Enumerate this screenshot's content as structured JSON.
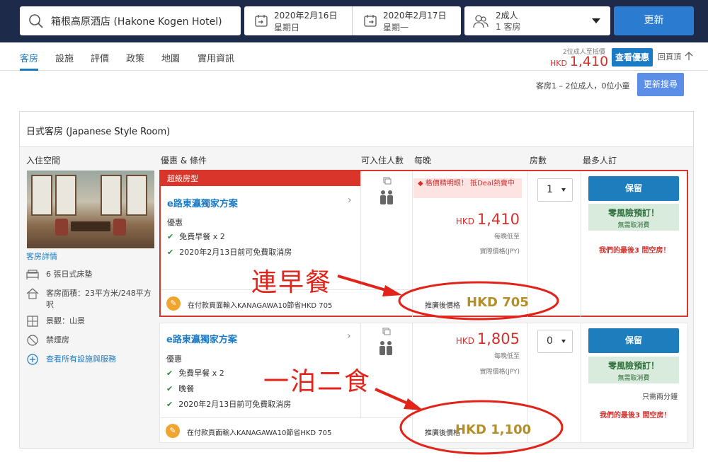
{
  "header": {
    "search_value": "箱根高原酒店 (Hakone Kogen Hotel)",
    "checkin_date": "2020年2月16日",
    "checkin_day": "星期日",
    "checkout_date": "2020年2月17日",
    "checkout_day": "星期一",
    "guests": "2成人",
    "rooms": "1 客房",
    "update_label": "更新"
  },
  "nav": {
    "tabs": [
      "客房",
      "設施",
      "評價",
      "政策",
      "地圖",
      "實用資訊"
    ],
    "price_caption": "2位成人至抵價",
    "price_currency": "HKD",
    "price_amount": "1,410",
    "view_deal_label": "查看優惠",
    "back_top_label": "回頁頂"
  },
  "occupancy": {
    "text": "客房1 – 2位成人，0位小童",
    "update_search_label": "更新搜尋"
  },
  "room": {
    "title": "日式客房 (Japanese Style Room)",
    "columns": [
      "入住空間",
      "優惠 & 條件",
      "可入住人數",
      "每晚",
      "房數",
      "最多人訂"
    ],
    "details_link": "客房詳情",
    "features": [
      {
        "icon": "bed-icon",
        "label": "6 張日式床墊"
      },
      {
        "icon": "house-icon",
        "label": "客房面積：23平方米/248平方呎"
      },
      {
        "icon": "window-icon",
        "label": "景觀：山景"
      },
      {
        "icon": "no-smoking-icon",
        "label": "禁煙房"
      }
    ],
    "all_facilities_link": "查看所有設施與服務"
  },
  "offers": [
    {
      "badge": "超級房型",
      "plan_name": "e路東瀛獨家方案",
      "perks_heading": "優惠",
      "perks": [
        "免費早餐 x 2",
        "2020年2月13日前可免費取消房"
      ],
      "promo_text": "在付款頁面輸入KANAGAWA10節省HKD 705",
      "deal_tag": "格價精明眼！ 抵Deal熱賣中",
      "currency": "HKD",
      "price": "1,410",
      "per_night": "每晚低至",
      "actual_price": "實際價格(JPY)",
      "after_discount_label": "推廣後價格",
      "after_discount_price": "HKD 705",
      "qty": "1",
      "reserve_label": "保留",
      "norisk_title": "零風險預訂！",
      "norisk_sub": "無需取消費",
      "availability": "我們的最後3 間空房！"
    },
    {
      "plan_name": "e路東瀛獨家方案",
      "perks_heading": "優惠",
      "perks": [
        "免費早餐 x 2",
        "晚餐",
        "2020年2月13日前可免費取消房"
      ],
      "promo_text": "在付款頁面輸入KANAGAWA10節省HKD 705",
      "currency": "HKD",
      "price": "1,805",
      "per_night": "每晚低至",
      "actual_price": "實際價格(JPY)",
      "after_discount_label": "推廣後價格",
      "after_discount_price": "HKD 1,100",
      "qty": "0",
      "reserve_label": "保留",
      "norisk_title": "零風險預訂！",
      "norisk_sub": "無需取消費",
      "urgency": "只需兩分鐘",
      "availability": "我們的最後3 間空房！"
    }
  ],
  "annotations": {
    "first": "連早餐",
    "second": "一泊二食",
    "color": "#e2231a"
  }
}
